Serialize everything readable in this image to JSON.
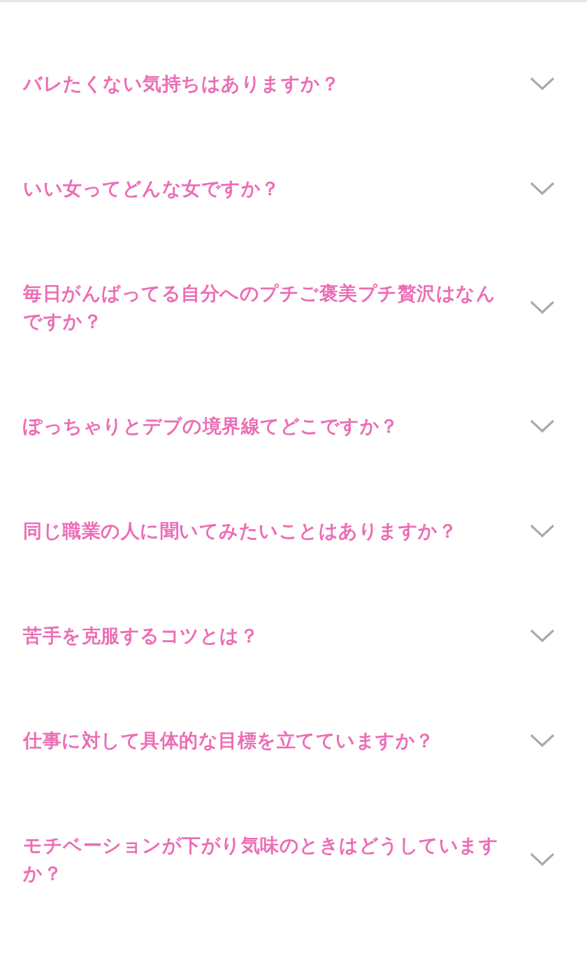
{
  "faq": [
    {
      "question": "バレたくない気持ちはありますか？",
      "expanded": false
    },
    {
      "question": "いい女ってどんな女ですか？",
      "expanded": false
    },
    {
      "question": "毎日がんばってる自分へのプチご褒美プチ贅沢はなんですか？",
      "expanded": false
    },
    {
      "question": "ぽっちゃりとデブの境界線てどこですか？",
      "expanded": false
    },
    {
      "question": "同じ職業の人に聞いてみたいことはありますか？",
      "expanded": false
    },
    {
      "question": "苦手を克服するコツとは？",
      "expanded": false
    },
    {
      "question": "仕事に対して具体的な目標を立てていますか？",
      "expanded": false
    },
    {
      "question": "モチベーションが下がり気味のときはどうしていますか？",
      "expanded": false
    }
  ]
}
